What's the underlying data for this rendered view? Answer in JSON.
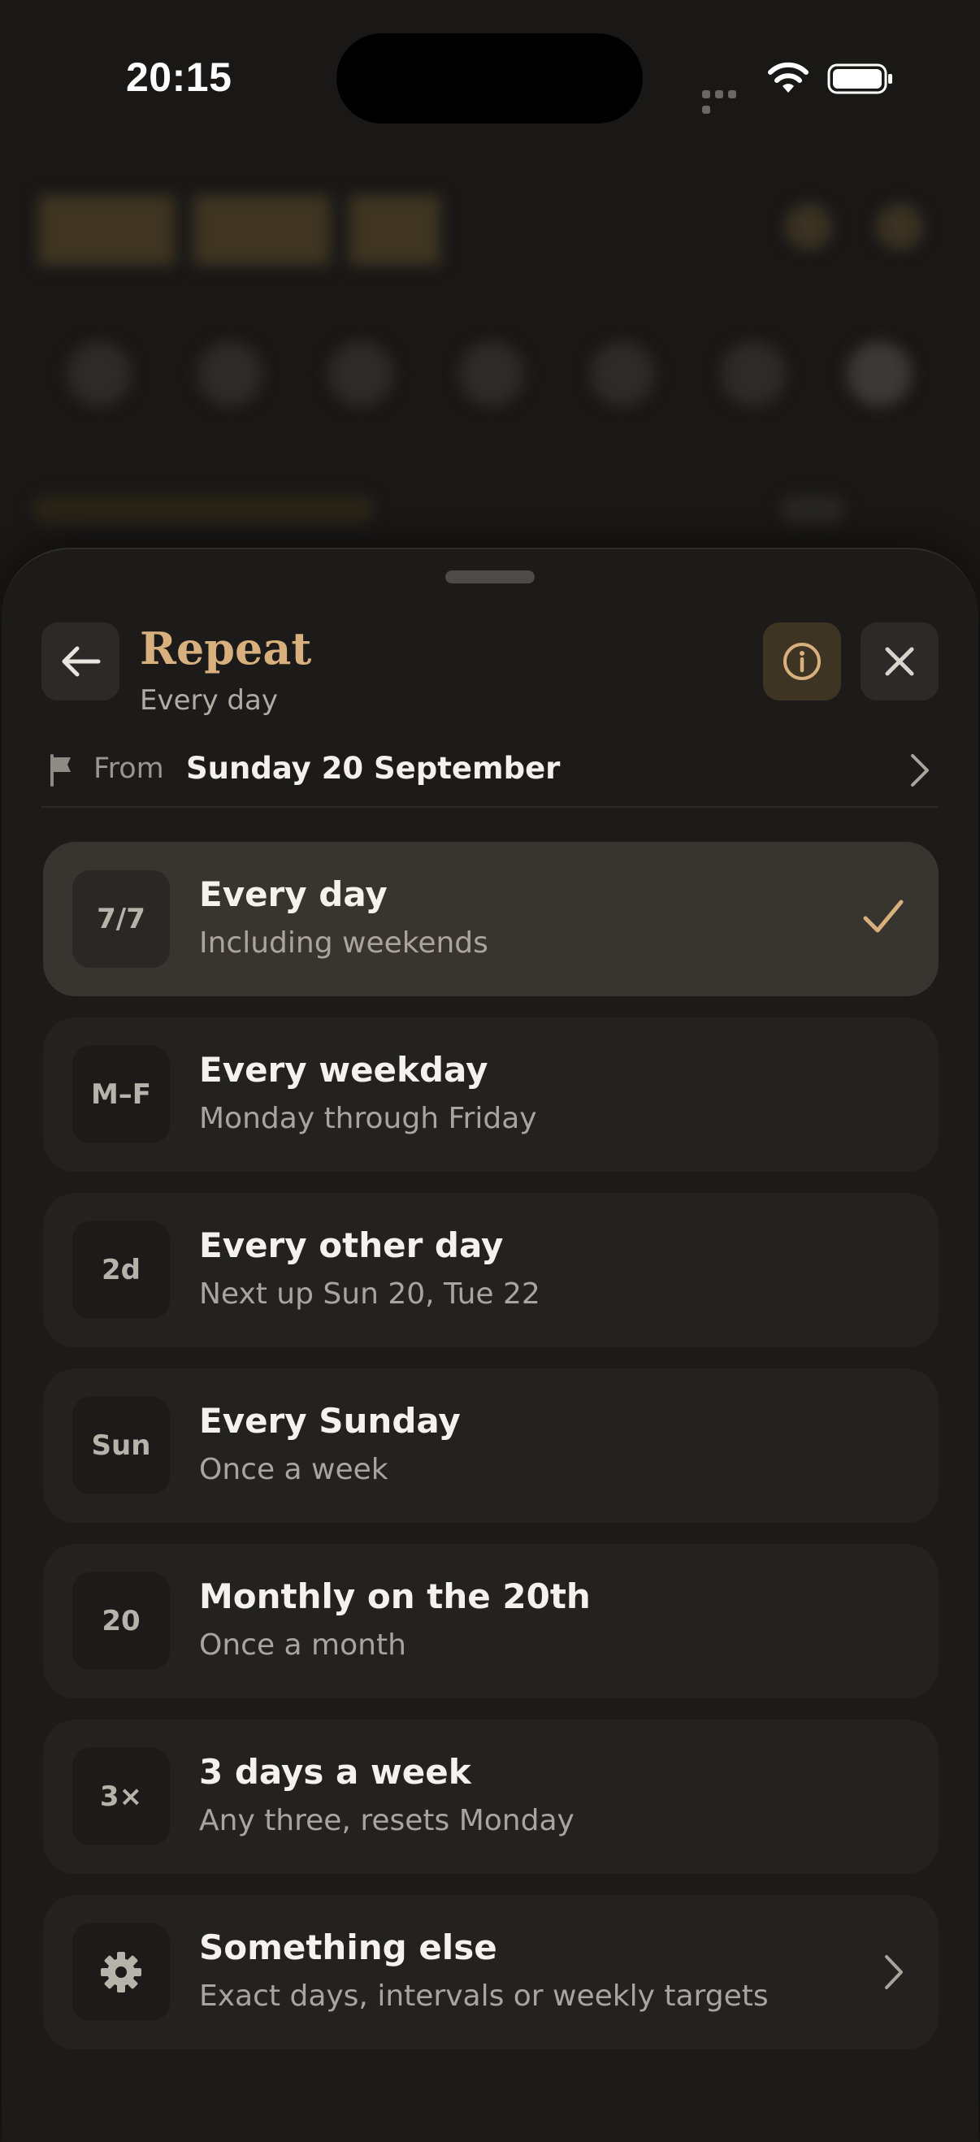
{
  "status_bar": {
    "time": "20:15"
  },
  "sheet": {
    "title": "Repeat",
    "subtitle": "Every day",
    "from_label": "From",
    "from_date": "Sunday 20 September"
  },
  "options": [
    {
      "badge": "7/7",
      "title": "Every day",
      "subtitle": "Including weekends",
      "selected": true
    },
    {
      "badge": "M–F",
      "title": "Every weekday",
      "subtitle": "Monday through Friday",
      "selected": false
    },
    {
      "badge": "2d",
      "title": "Every other day",
      "subtitle": "Next up Sun 20, Tue 22",
      "selected": false
    },
    {
      "badge": "Sun",
      "title": "Every Sunday",
      "subtitle": "Once a week",
      "selected": false
    },
    {
      "badge": "20",
      "title": "Monthly on the 20th",
      "subtitle": "Once a month",
      "selected": false
    },
    {
      "badge": "3×",
      "title": "3 days a week",
      "subtitle": "Any three, resets Monday",
      "selected": false
    },
    {
      "badge_icon": "gear-icon",
      "title": "Something else",
      "subtitle": "Exact days, intervals or weekly targets",
      "selected": false
    }
  ],
  "colors": {
    "accent": "#d8b07d",
    "sheet_bg": "#1c1b19",
    "card_bg": "#232220",
    "card_selected_bg": "#38342f"
  }
}
